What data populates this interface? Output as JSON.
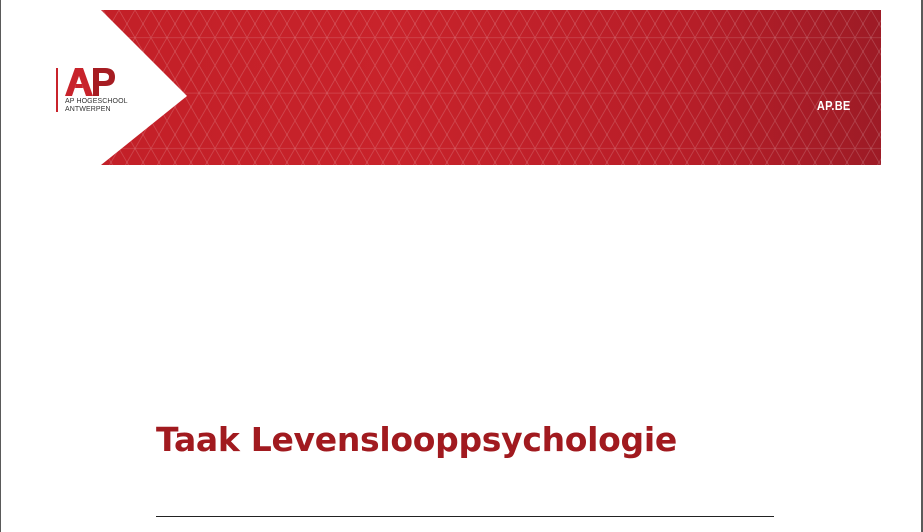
{
  "header": {
    "site_label": "AP.BE",
    "logo": {
      "mark_text": "AP",
      "line1": "AP HOGESCHOOL",
      "line2": "ANTWERPEN"
    }
  },
  "document": {
    "title": "Taak Levenslooppsychologie"
  },
  "colors": {
    "brand_red": "#c8232b",
    "title_red": "#a11a1f"
  }
}
